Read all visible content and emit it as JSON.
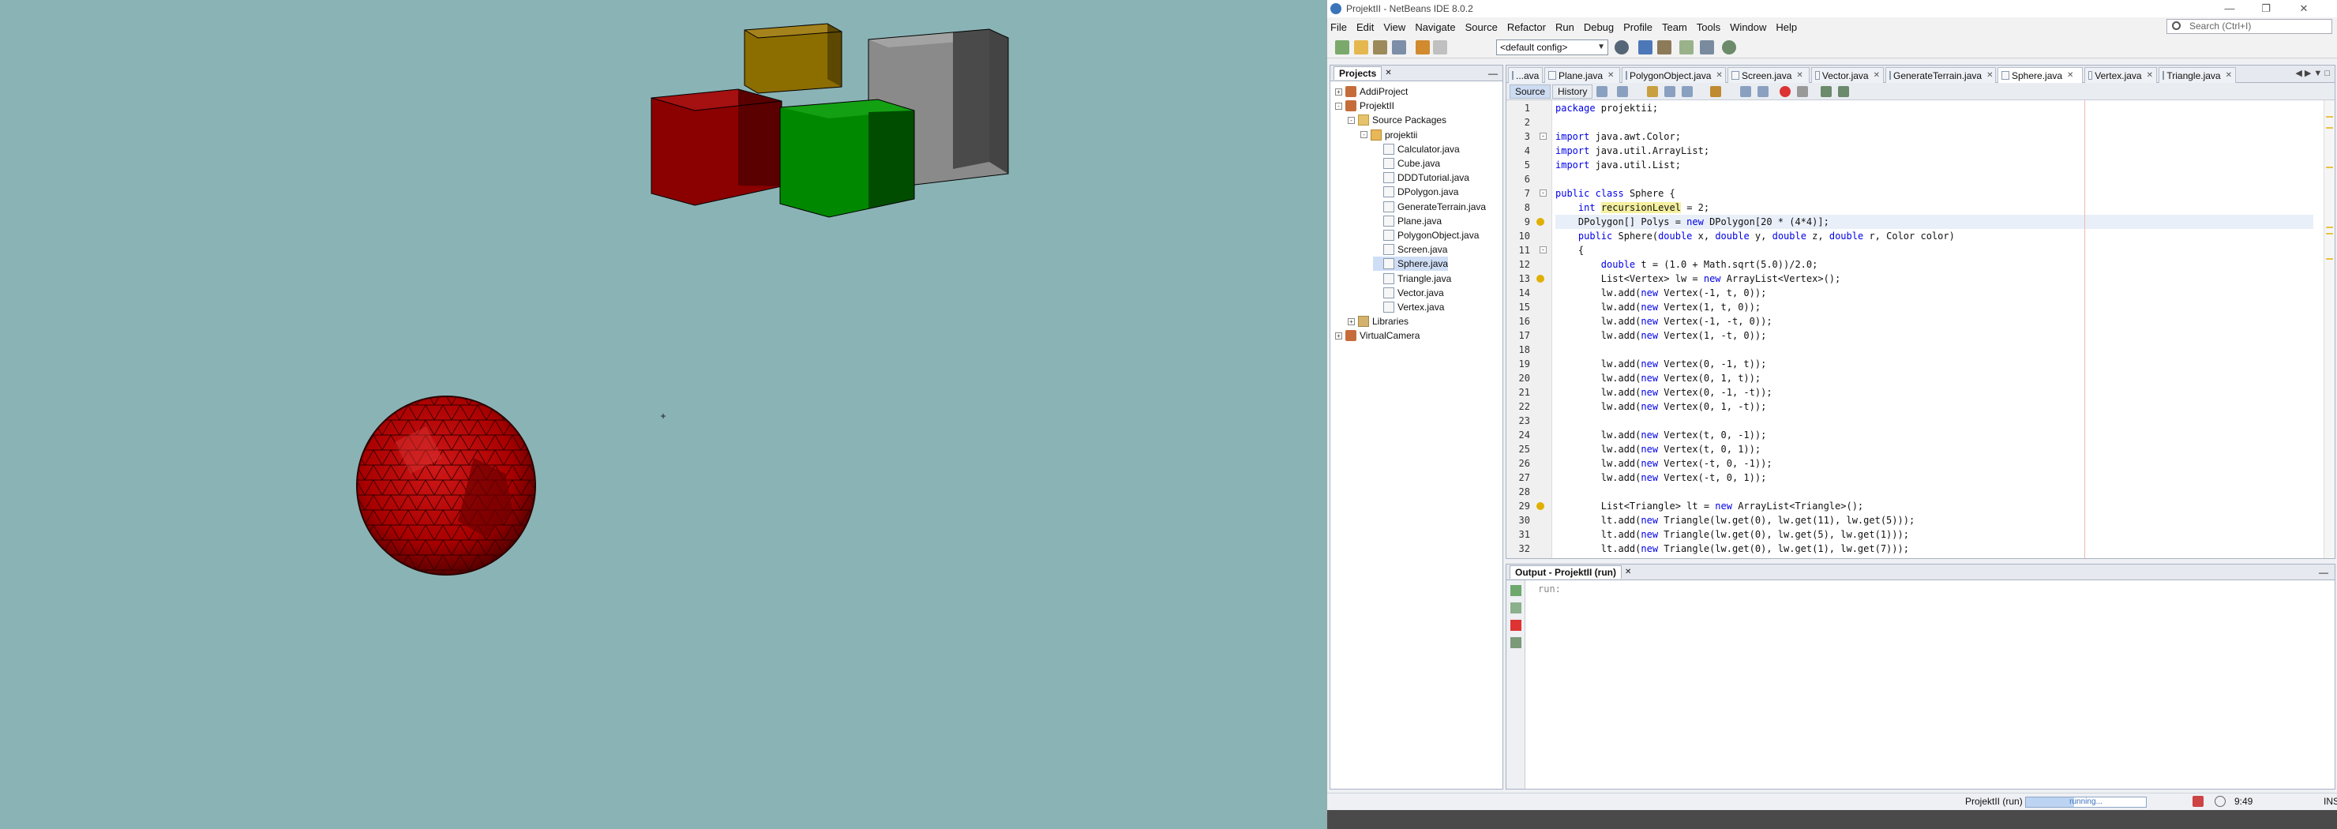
{
  "window": {
    "title": "ProjektII - NetBeans IDE 8.0.2"
  },
  "menu": [
    "File",
    "Edit",
    "View",
    "Navigate",
    "Source",
    "Refactor",
    "Run",
    "Debug",
    "Profile",
    "Team",
    "Tools",
    "Window",
    "Help"
  ],
  "search": {
    "placeholder": "Search (Ctrl+I)"
  },
  "toolbar": {
    "config": "<default config>"
  },
  "projects": {
    "tab": "Projects",
    "items": [
      {
        "label": "AddiProject",
        "level": 0,
        "icon": "project-icon",
        "toggle": "+"
      },
      {
        "label": "ProjektII",
        "level": 0,
        "icon": "project-icon",
        "toggle": "-"
      },
      {
        "label": "Source Packages",
        "level": 1,
        "icon": "folder-icon",
        "toggle": "-"
      },
      {
        "label": "projektii",
        "level": 2,
        "icon": "package-icon",
        "toggle": "-"
      },
      {
        "label": "Calculator.java",
        "level": 3,
        "icon": "java-file-icon"
      },
      {
        "label": "Cube.java",
        "level": 3,
        "icon": "java-file-icon"
      },
      {
        "label": "DDDTutorial.java",
        "level": 3,
        "icon": "java-file-icon"
      },
      {
        "label": "DPolygon.java",
        "level": 3,
        "icon": "java-file-icon"
      },
      {
        "label": "GenerateTerrain.java",
        "level": 3,
        "icon": "java-file-icon"
      },
      {
        "label": "Plane.java",
        "level": 3,
        "icon": "java-file-icon"
      },
      {
        "label": "PolygonObject.java",
        "level": 3,
        "icon": "java-file-icon"
      },
      {
        "label": "Screen.java",
        "level": 3,
        "icon": "java-file-icon"
      },
      {
        "label": "Sphere.java",
        "level": 3,
        "icon": "java-file-icon",
        "selected": true
      },
      {
        "label": "Triangle.java",
        "level": 3,
        "icon": "java-file-icon"
      },
      {
        "label": "Vector.java",
        "level": 3,
        "icon": "java-file-icon"
      },
      {
        "label": "Vertex.java",
        "level": 3,
        "icon": "java-file-icon"
      },
      {
        "label": "Libraries",
        "level": 1,
        "icon": "library-icon",
        "toggle": "+"
      },
      {
        "label": "VirtualCamera",
        "level": 0,
        "icon": "project-icon",
        "toggle": "+"
      }
    ]
  },
  "editor": {
    "tabs": [
      "...ava",
      "Plane.java",
      "PolygonObject.java",
      "Screen.java",
      "Vector.java",
      "GenerateTerrain.java",
      "Sphere.java",
      "Vertex.java",
      "Triangle.java"
    ],
    "active_tab": "Sphere.java",
    "source_label": "Source",
    "history_label": "History",
    "lines": [
      "package projektii;",
      "",
      "import java.awt.Color;",
      "import java.util.ArrayList;",
      "import java.util.List;",
      "",
      "public class Sphere {",
      "    int recursionLevel = 2;",
      "    DPolygon[] Polys = new DPolygon[20 * (4*4)];",
      "    public Sphere(double x, double y, double z, double r, Color color)",
      "    {",
      "        double t = (1.0 + Math.sqrt(5.0))/2.0;",
      "        List<Vertex> lw = new ArrayList<Vertex>();",
      "        lw.add(new Vertex(-1, t, 0));",
      "        lw.add(new Vertex(1, t, 0));",
      "        lw.add(new Vertex(-1, -t, 0));",
      "        lw.add(new Vertex(1, -t, 0));",
      "",
      "        lw.add(new Vertex(0, -1, t));",
      "        lw.add(new Vertex(0, 1, t));",
      "        lw.add(new Vertex(0, -1, -t));",
      "        lw.add(new Vertex(0, 1, -t));",
      "",
      "        lw.add(new Vertex(t, 0, -1));",
      "        lw.add(new Vertex(t, 0, 1));",
      "        lw.add(new Vertex(-t, 0, -1));",
      "        lw.add(new Vertex(-t, 0, 1));",
      "",
      "        List<Triangle> lt = new ArrayList<Triangle>();",
      "        lt.add(new Triangle(lw.get(0), lw.get(11), lw.get(5)));",
      "        lt.add(new Triangle(lw.get(0), lw.get(5), lw.get(1)));",
      "        lt.add(new Triangle(lw.get(0), lw.get(1), lw.get(7)));"
    ]
  },
  "output": {
    "tab": "Output - ProjektII (run)",
    "text": "run:"
  },
  "status": {
    "project": "ProjektII (run)",
    "progress": "running...",
    "time": "9:49",
    "mode": "INS"
  },
  "colors": {
    "scene_bg": "#8ab3b5",
    "keyword": "#0000e6",
    "cube_red": "#8b0000",
    "cube_green": "#008800",
    "cube_gold": "#8c6d00",
    "cube_gray": "#8a8a8a",
    "sphere": "#b00000"
  }
}
